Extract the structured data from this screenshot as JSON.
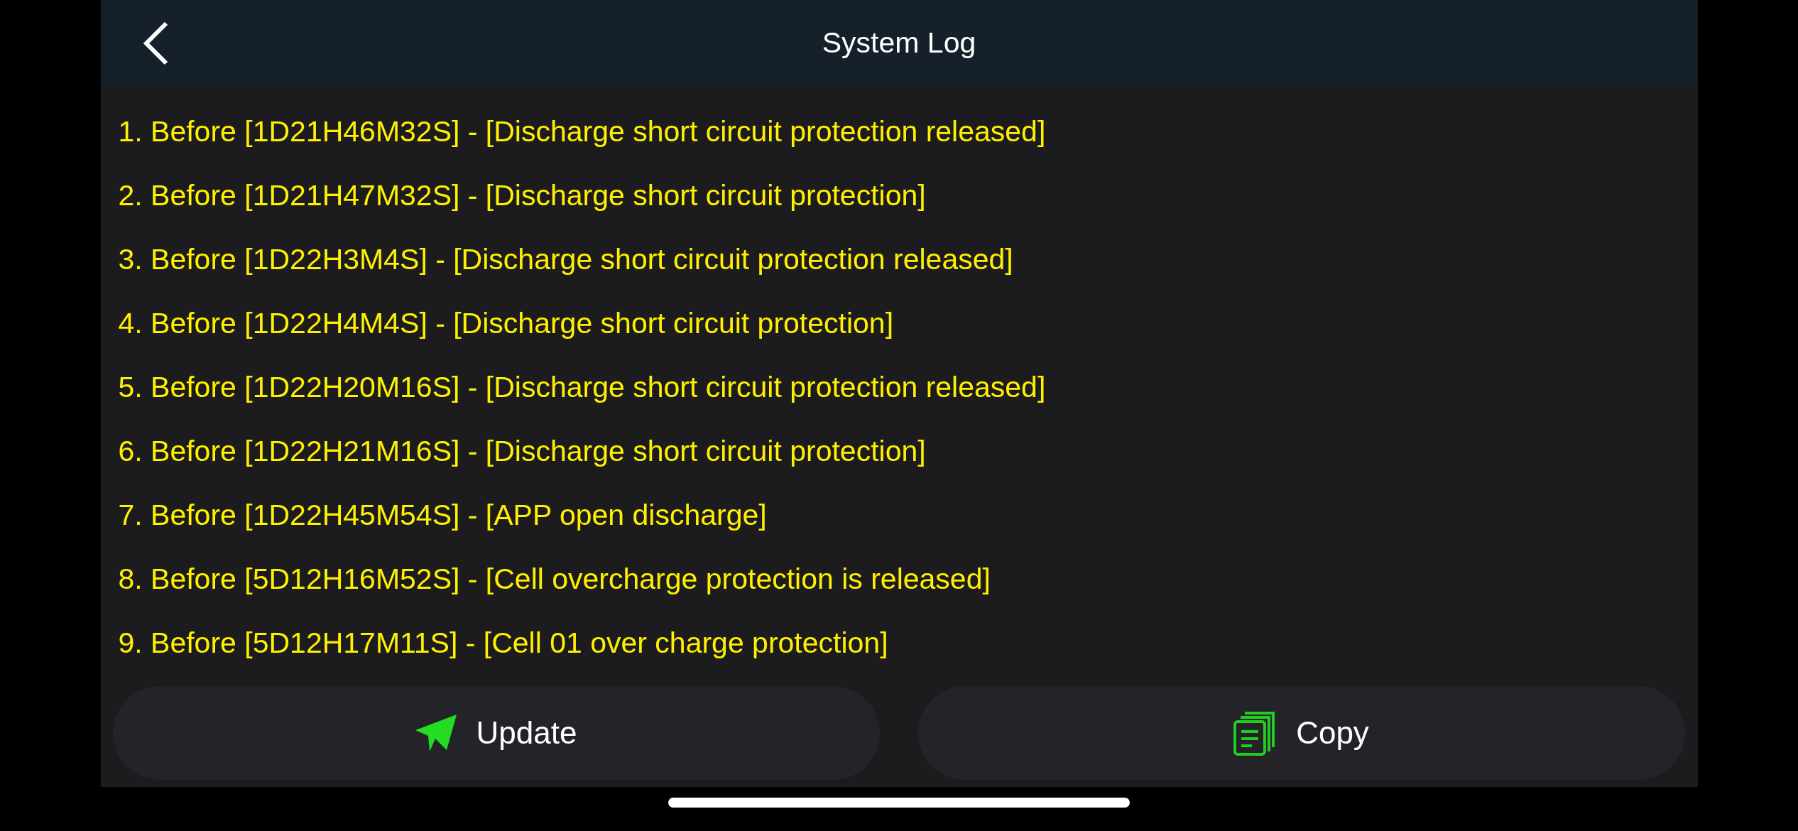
{
  "header": {
    "title": "System Log"
  },
  "log": [
    "1. Before [1D21H46M32S] - [Discharge short circuit protection released]",
    "2. Before [1D21H47M32S] - [Discharge short circuit protection]",
    "3. Before [1D22H3M4S] - [Discharge short circuit protection released]",
    "4. Before [1D22H4M4S] - [Discharge short circuit protection]",
    "5. Before [1D22H20M16S] - [Discharge short circuit protection released]",
    "6. Before [1D22H21M16S] - [Discharge short circuit protection]",
    "7. Before [1D22H45M54S] - [APP open discharge]",
    "8. Before [5D12H16M52S] - [Cell overcharge protection is released]",
    "9. Before [5D12H17M11S] - [Cell 01 over charge protection]"
  ],
  "buttons": [
    {
      "kind": "update",
      "label": "Update"
    },
    {
      "kind": "copy",
      "label": "Copy"
    }
  ]
}
